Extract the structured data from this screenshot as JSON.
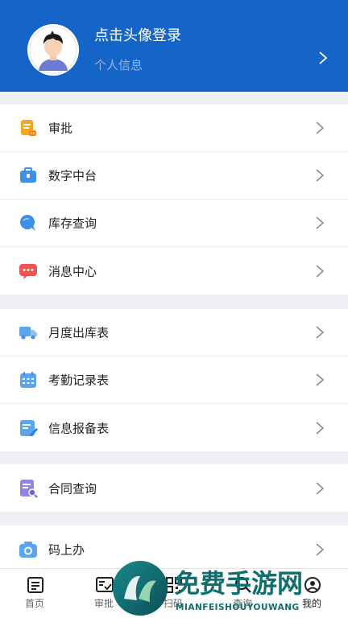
{
  "header": {
    "login_title": "点击头像登录",
    "login_subtitle": "个人信息",
    "bg_color": "#1565c8"
  },
  "groups": [
    {
      "items": [
        {
          "label": "审批",
          "icon": "approval-doc-icon",
          "color": "#f5a623"
        },
        {
          "label": "数字中台",
          "icon": "briefcase-icon",
          "color": "#3d8fe8"
        },
        {
          "label": "库存查询",
          "icon": "chat-bubble-icon",
          "color": "#3d8fe8"
        },
        {
          "label": "消息中心",
          "icon": "message-icon",
          "color": "#f0534f"
        }
      ]
    },
    {
      "items": [
        {
          "label": "月度出库表",
          "icon": "truck-icon",
          "color": "#5aa4f0"
        },
        {
          "label": "考勤记录表",
          "icon": "calendar-icon",
          "color": "#5aa4f0"
        },
        {
          "label": "信息报备表",
          "icon": "edit-doc-icon",
          "color": "#5aa4f0"
        }
      ]
    },
    {
      "items": [
        {
          "label": "合同查询",
          "icon": "contract-search-icon",
          "color": "#8e86e8"
        }
      ]
    },
    {
      "items": [
        {
          "label": "码上办",
          "icon": "camera-icon",
          "color": "#5aa4f0"
        }
      ]
    }
  ],
  "tabbar": {
    "tabs": [
      {
        "label": "首页",
        "icon": "home-doc-icon"
      },
      {
        "label": "审批",
        "icon": "approval-check-icon"
      },
      {
        "label": "扫码",
        "icon": "qr-code-icon"
      },
      {
        "label": "查询",
        "icon": "search-icon"
      },
      {
        "label": "我的",
        "icon": "profile-icon",
        "active": true
      }
    ]
  },
  "watermark": {
    "cn_text": "免费手游网",
    "en_text": "MIANFEISHOUYOUWANG"
  }
}
